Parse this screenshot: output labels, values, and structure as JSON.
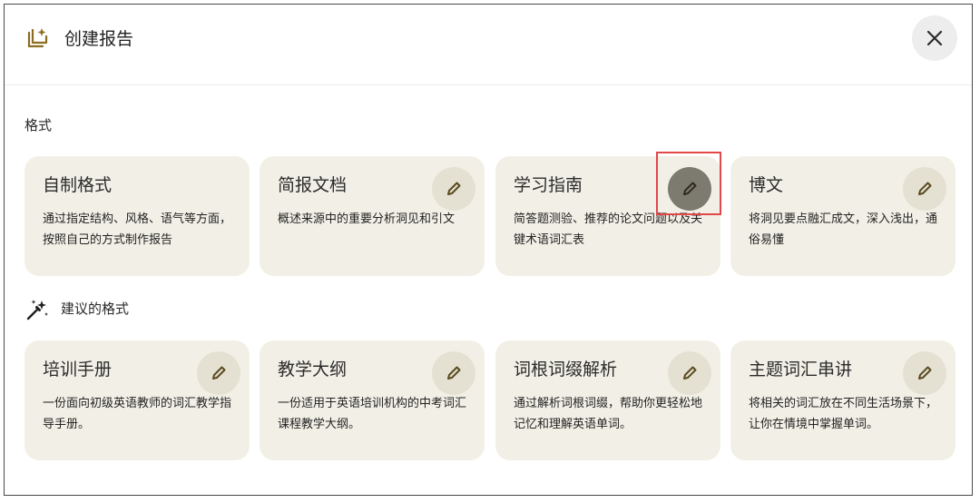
{
  "header": {
    "title": "创建报告",
    "icon": "report-add-icon",
    "close_icon": "close-icon"
  },
  "format_section": {
    "label": "格式",
    "cards": [
      {
        "title": "自制格式",
        "description": "通过指定结构、风格、语气等方面，按照自己的方式制作报告",
        "has_edit": false
      },
      {
        "title": "简报文档",
        "description": "概述来源中的重要分析洞见和引文",
        "has_edit": true
      },
      {
        "title": "学习指南",
        "description": "简答题测验、推荐的论文问题以及关键术语词汇表",
        "has_edit": true,
        "highlighted": true
      },
      {
        "title": "博文",
        "description": "将洞见要点融汇成文，深入浅出，通俗易懂",
        "has_edit": true
      }
    ]
  },
  "suggested_section": {
    "label": "建议的格式",
    "icon": "magic-wand-icon",
    "cards": [
      {
        "title": "培训手册",
        "description": "一份面向初级英语教师的词汇教学指导手册。",
        "has_edit": true
      },
      {
        "title": "教学大纲",
        "description": "一份适用于英语培训机构的中考词汇课程教学大纲。",
        "has_edit": true
      },
      {
        "title": "词根词缀解析",
        "description": "通过解析词根词缀，帮助你更轻松地记忆和理解英语单词。",
        "has_edit": true
      },
      {
        "title": "主题词汇串讲",
        "description": "将相关的词汇放在不同生活场景下，让你在情境中掌握单词。",
        "has_edit": true
      }
    ]
  },
  "colors": {
    "card_bg": "#f2f0e6",
    "edit_btn_bg": "#e4e1d3",
    "edit_btn_active_bg": "#7d7a6f",
    "accent_brown": "#8a6d1f",
    "highlight_red": "#e2474a"
  }
}
